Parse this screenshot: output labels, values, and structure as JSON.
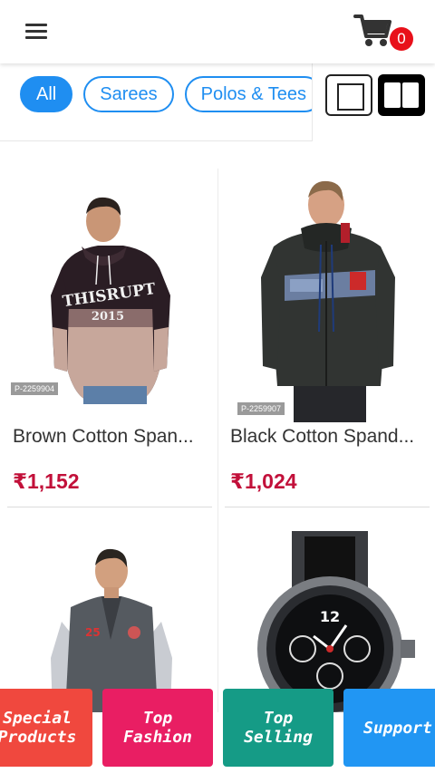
{
  "header": {
    "cart_count": "0"
  },
  "categories": {
    "chips": [
      "All",
      "Sarees",
      "Polos & Tees"
    ],
    "active": "All"
  },
  "products": [
    {
      "code": "P-2259904",
      "name": "Brown Cotton Span...",
      "price": "₹1,152"
    },
    {
      "code": "P-2259907",
      "name": "Black Cotton Spand...",
      "price": "₹1,024"
    },
    {
      "code": "",
      "name": "",
      "price": ""
    },
    {
      "code": "",
      "name": "",
      "price": ""
    }
  ],
  "bottom_nav": {
    "special_products": "Special Products",
    "top_fashion": "Top Fashion",
    "top_selling": "Top Selling",
    "support": "Support"
  },
  "colors": {
    "accent_blue": "#1f8ef1",
    "price_red": "#c2103a",
    "badge_red": "#e8101a",
    "nav_red": "#f0483e",
    "nav_pink": "#e91e63",
    "nav_teal": "#159b86",
    "nav_blue": "#2196f3"
  }
}
